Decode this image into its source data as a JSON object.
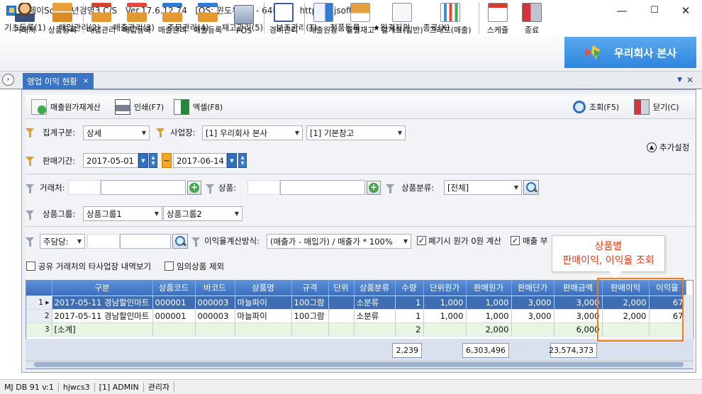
{
  "window": {
    "title": "엠제이Soft 천년경영3 C/S   Ver.17.6.12.74   [OS: 윈도우 10 - 64비트]   http://mjsoft.co",
    "min": "—",
    "max": "☐",
    "close": "✕"
  },
  "menu": [
    "기초등록(1)",
    "매입관리(2)",
    "매출관리(3)",
    "주문관리(4)",
    "재고관리(5)",
    "보조관리(T)",
    "정품등록",
    "★원격지원",
    "종료(X)"
  ],
  "toolbar": [
    "거래처",
    "상품등록",
    "매입관리",
    "매입등록",
    "매출관리",
    "매출등록",
    "POS",
    "경비관리",
    "매출원장",
    "일별재고",
    "일계표(일반)",
    "그래프(매출)",
    "스케쥴",
    "종료"
  ],
  "brand": "우리회사 본사",
  "tab": {
    "label": "영업 이익 현황",
    "close": "×"
  },
  "actions": {
    "recalc": "매출원가재계산",
    "print": "인쇄(F7)",
    "excel": "엑셀(F8)",
    "search": "조회(F5)",
    "close": "닫기(C)"
  },
  "filters": {
    "agg_label": "집계구분:",
    "agg_value": "상세",
    "site_label": "사업장:",
    "site_value": "[1] 우리회사 본사",
    "warehouse_value": "[1] 기본창고",
    "period_label": "판매기간:",
    "date_from": "2017-05-01",
    "date_to": "2017-06-14",
    "tilde": "~",
    "more": "추가설정",
    "client_label": "거래처:",
    "product_label": "상품:",
    "category_label": "상품분류:",
    "category_value": "[전체]",
    "group_label": "상품그룹:",
    "group1": "상품그룹1",
    "group2": "상품그룹2",
    "manager_label": "주담당:",
    "calc_label": "이익율계산방식:",
    "calc_value": "(매출가 - 매입가) / 매출가 * 100%",
    "chk_waste": "폐기시 원가 0원 계산",
    "chk_sales": "매출 부",
    "chk_share": "공유 거래처의 타사업장 내역보기",
    "chk_temp": "임의상품 제외"
  },
  "grid": {
    "headers": [
      "",
      "구분",
      "상품코드",
      "바코드",
      "상품명",
      "규격",
      "단위",
      "상품분류",
      "수량",
      "단위원가",
      "판매원가",
      "판매단가",
      "판매금액",
      "판매이익",
      "이익율"
    ],
    "rows": [
      [
        "1",
        "2017-05-11 경남할인마트",
        "000001",
        "000003",
        "마늘파이",
        "100그람",
        "",
        "소분류",
        "1",
        "1,000",
        "1,000",
        "3,000",
        "3,000",
        "2,000",
        "67"
      ],
      [
        "2",
        "2017-05-11 경남할인마트",
        "000001",
        "000003",
        "마늘파이",
        "100그람",
        "",
        "소분류",
        "1",
        "1,000",
        "1,000",
        "3,000",
        "3,000",
        "2,000",
        "67"
      ],
      [
        "3",
        "[소계]",
        "",
        "",
        "",
        "",
        "",
        "",
        "2",
        "",
        "2,000",
        "",
        "6,000",
        "",
        ""
      ]
    ],
    "totals": {
      "qty": "2,239",
      "cost": "6,303,496",
      "amount": "23,574,373"
    }
  },
  "callout": {
    "line1": "상품별",
    "line2": "판매이익, 이익율 조회"
  },
  "status": [
    "MJ DB 91 v:1",
    "hjwcs3",
    "[1] ADMIN",
    "관리자"
  ],
  "colors": {
    "accent": "#3c74c4",
    "highlight": "#f07b1a",
    "callout_text": "#e03a10"
  }
}
